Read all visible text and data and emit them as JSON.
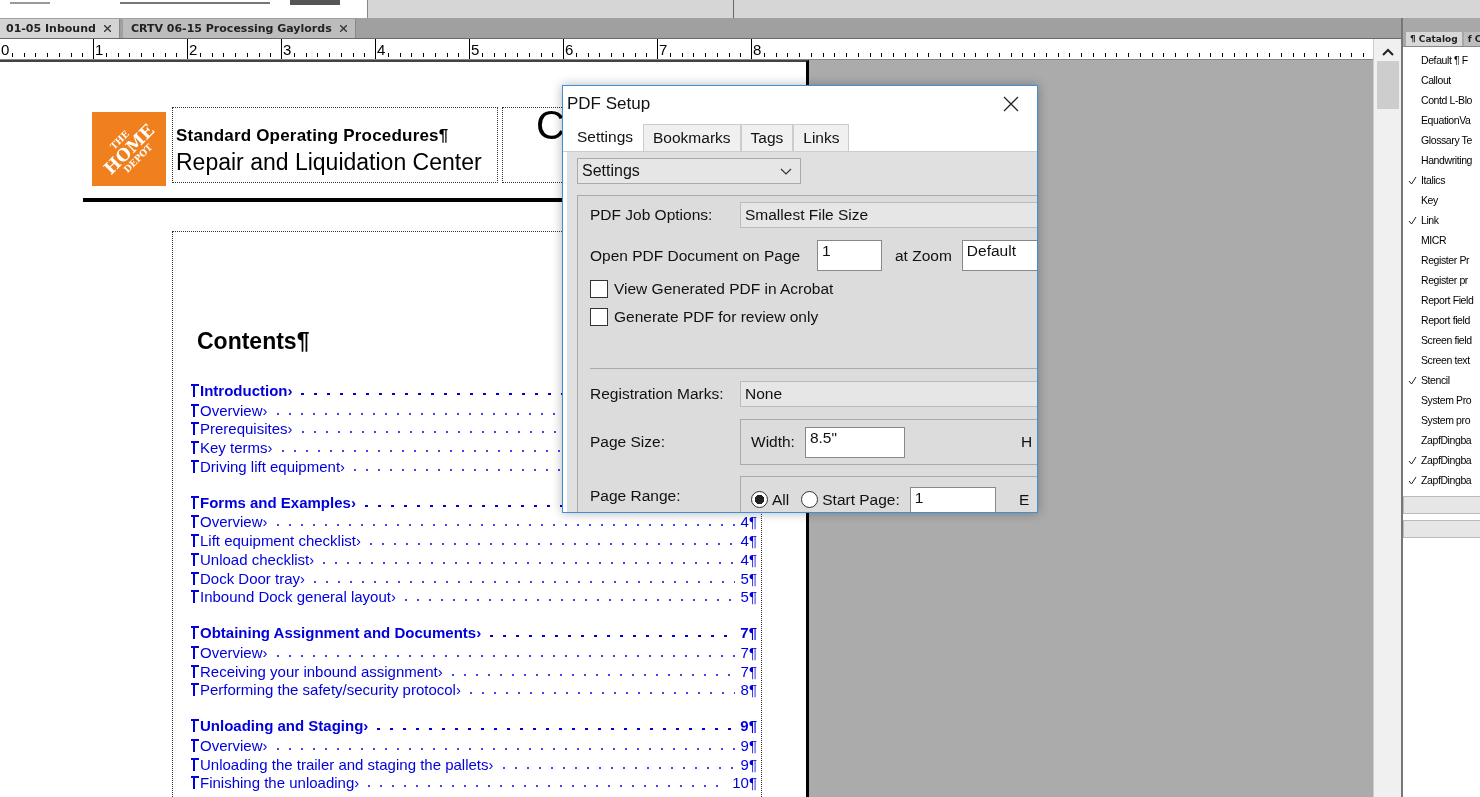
{
  "doc_tabs": [
    {
      "label": "01-05 Inbound",
      "selected": true
    },
    {
      "label": "CRTV 06-15 Processing Gaylords",
      "selected": false
    }
  ],
  "ruler": {
    "numbers": [
      "0",
      "1",
      "2",
      "3",
      "4",
      "5",
      "6",
      "7",
      "8"
    ]
  },
  "page": {
    "logo": {
      "lines": [
        "THE",
        "HOME",
        "DEPOT"
      ]
    },
    "header_title": "Standard Operating Procedures¶",
    "header_subtitle": "Repair and Liquidation Center",
    "header_right": "C",
    "toc": {
      "title": "Contents¶",
      "sections": [
        {
          "title": "Introduction›",
          "entries": [
            {
              "title": "Overview›"
            },
            {
              "title": "Prerequisites›"
            },
            {
              "title": "Key terms›"
            },
            {
              "title": "Driving lift equipment›"
            }
          ]
        },
        {
          "title": "Forms and Examples›",
          "entries": [
            {
              "title": "Overview›",
              "page": "4¶"
            },
            {
              "title": "Lift equipment checklist›",
              "page": "4¶"
            },
            {
              "title": "Unload checklist›",
              "page": "4¶"
            },
            {
              "title": "Dock Door tray›",
              "page": "5¶"
            },
            {
              "title": "Inbound Dock general layout›",
              "page": "5¶"
            }
          ]
        },
        {
          "title": "Obtaining Assignment and Documents›",
          "page": "7¶",
          "entries": [
            {
              "title": "Overview›",
              "page": "7¶"
            },
            {
              "title": "Receiving your inbound assignment›",
              "page": "7¶"
            },
            {
              "title": "Performing the safety/security protocol›",
              "page": "8¶"
            }
          ]
        },
        {
          "title": "Unloading and Staging›",
          "page": "9¶",
          "entries": [
            {
              "title": "Overview›",
              "page": "9¶"
            },
            {
              "title": "Unloading the trailer and staging the pallets›",
              "page": "9¶"
            },
            {
              "title": "Finishing the unloading›",
              "page": "10¶"
            }
          ]
        }
      ]
    }
  },
  "catalog": {
    "tabs": [
      {
        "label": "¶ Catalog",
        "selected": true
      },
      {
        "label": "f C",
        "selected": false
      }
    ],
    "items": [
      {
        "label": "Default ¶ F",
        "checked": false
      },
      {
        "label": "Callout",
        "checked": false
      },
      {
        "label": "Contd L-Blo",
        "checked": false
      },
      {
        "label": "EquationVa",
        "checked": false
      },
      {
        "label": "Glossary Te",
        "checked": false
      },
      {
        "label": "Handwriting",
        "checked": false
      },
      {
        "label": "Italics",
        "checked": true
      },
      {
        "label": "Key",
        "checked": false
      },
      {
        "label": "Link",
        "checked": true
      },
      {
        "label": "MICR",
        "checked": false
      },
      {
        "label": "Register Pr",
        "checked": false
      },
      {
        "label": "Register pr",
        "checked": false
      },
      {
        "label": "Report Field",
        "checked": false
      },
      {
        "label": "Report field",
        "checked": false
      },
      {
        "label": "Screen field",
        "checked": false
      },
      {
        "label": "Screen text",
        "checked": false
      },
      {
        "label": "Stencil",
        "checked": true
      },
      {
        "label": "System Pro",
        "checked": false
      },
      {
        "label": "System pro",
        "checked": false
      },
      {
        "label": "ZapfDingba",
        "checked": false
      },
      {
        "label": "ZapfDingba",
        "checked": true
      },
      {
        "label": "ZapfDingba",
        "checked": true
      }
    ]
  },
  "dialog": {
    "title": "PDF Setup",
    "tabs": [
      {
        "label": "Settings",
        "selected": true
      },
      {
        "label": "Bookmarks",
        "selected": false
      },
      {
        "label": "Tags",
        "selected": false
      },
      {
        "label": "Links",
        "selected": false
      }
    ],
    "section_select": "Settings",
    "job_options_label": "PDF Job Options:",
    "job_options_value": "Smallest File Size",
    "open_page_label": "Open PDF Document on Page",
    "open_page_value": "1",
    "zoom_label": "at Zoom",
    "zoom_value": "Default",
    "checkboxes": [
      {
        "label": "View Generated PDF in Acrobat",
        "checked": false
      },
      {
        "label": "Generate PDF for review only",
        "checked": false
      }
    ],
    "registration_label": "Registration Marks:",
    "registration_value": "None",
    "page_size_label": "Page Size:",
    "width_label": "Width:",
    "width_value": "8.5\"",
    "height_label_cut": "H",
    "page_range_label": "Page Range:",
    "range_options": [
      {
        "label": "All",
        "selected": true
      },
      {
        "label": "Start Page:",
        "selected": false
      }
    ],
    "start_page_value": "1",
    "end_label_cut": "E"
  }
}
